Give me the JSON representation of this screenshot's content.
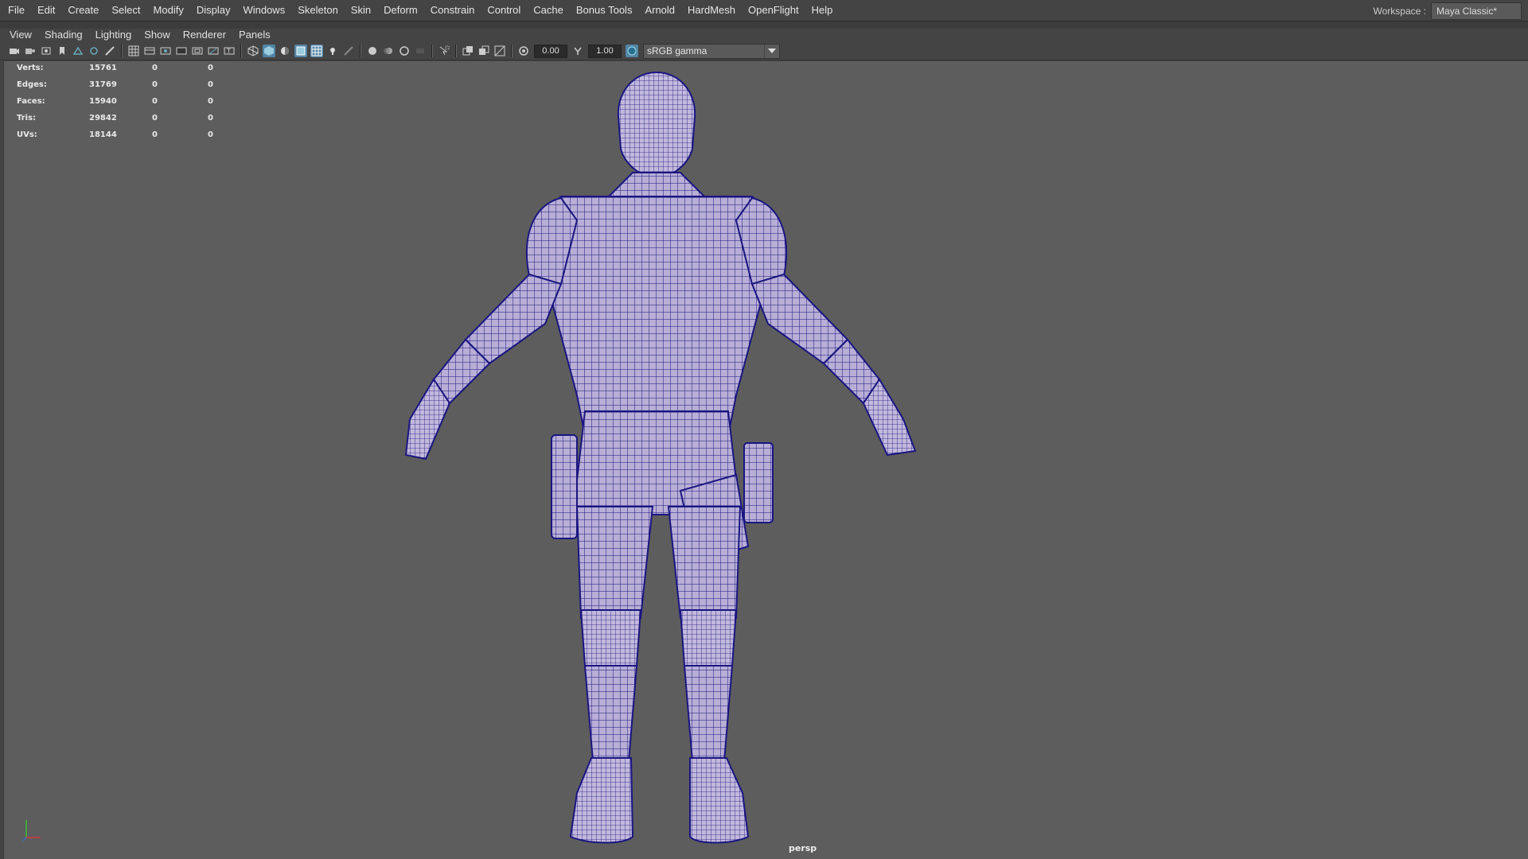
{
  "menubar": {
    "items": [
      "File",
      "Edit",
      "Create",
      "Select",
      "Modify",
      "Display",
      "Windows",
      "Skeleton",
      "Skin",
      "Deform",
      "Constrain",
      "Control",
      "Cache",
      "Bonus Tools",
      "Arnold",
      "HardMesh",
      "OpenFlight",
      "Help"
    ],
    "workspace_label": "Workspace :",
    "workspace_value": "Maya Classic*"
  },
  "panel_menu": {
    "items": [
      "View",
      "Shading",
      "Lighting",
      "Show",
      "Renderer",
      "Panels"
    ]
  },
  "toolbar": {
    "exposure_value": "0.00",
    "gamma_value": "1.00",
    "color_management": "sRGB gamma",
    "accent_color": "#5285a6"
  },
  "hud": {
    "rows": [
      {
        "label": "Verts:",
        "count": "15761",
        "selected": "0",
        "uv": "0"
      },
      {
        "label": "Edges:",
        "count": "31769",
        "selected": "0",
        "uv": "0"
      },
      {
        "label": "Faces:",
        "count": "15940",
        "selected": "0",
        "uv": "0"
      },
      {
        "label": "Tris:",
        "count": "29842",
        "selected": "0",
        "uv": "0"
      },
      {
        "label": "UVs:",
        "count": "18144",
        "selected": "0",
        "uv": "0"
      }
    ]
  },
  "viewport": {
    "camera_label": "persp",
    "background_color": "#5d5d5d",
    "wire_color": "#1a1580",
    "mesh_color": "#b8aed6"
  }
}
